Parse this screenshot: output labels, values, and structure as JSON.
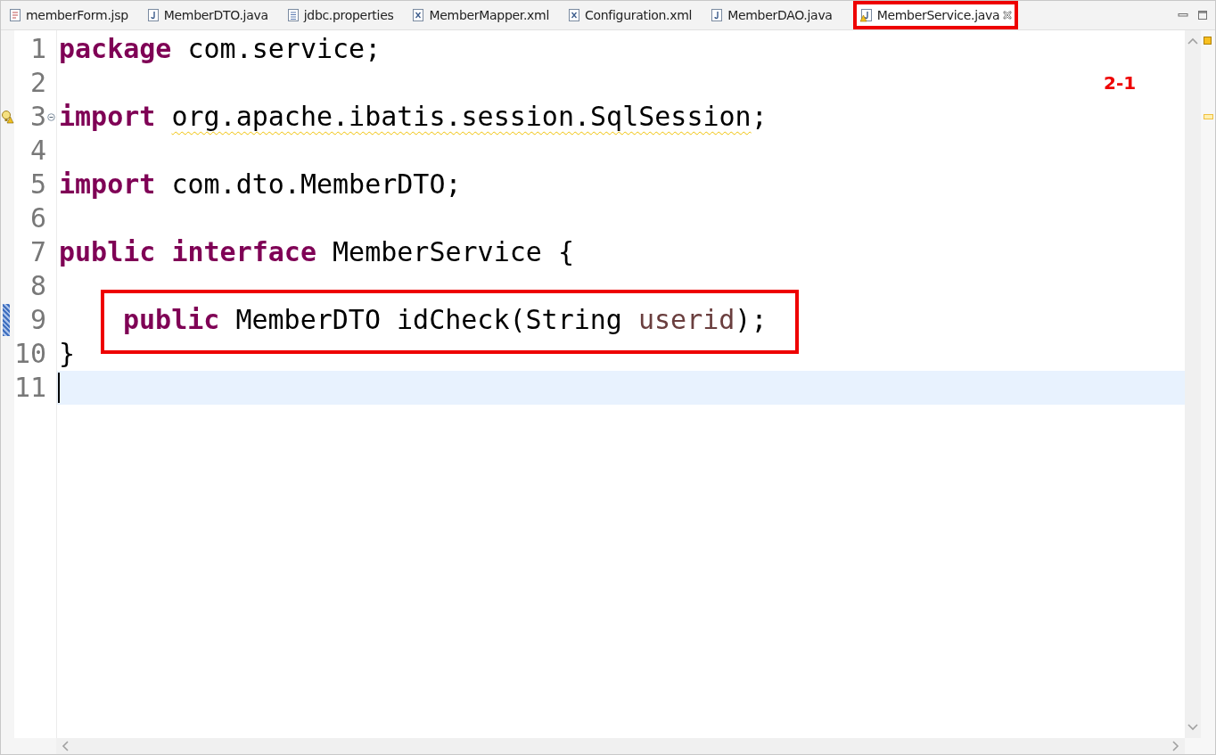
{
  "tabs": [
    {
      "label": "memberForm.jsp",
      "kind": "jsp",
      "selected": false,
      "highlighted": false
    },
    {
      "label": "MemberDTO.java",
      "kind": "java",
      "selected": false,
      "highlighted": false
    },
    {
      "label": "jdbc.properties",
      "kind": "properties",
      "selected": false,
      "highlighted": false
    },
    {
      "label": "MemberMapper.xml",
      "kind": "xml",
      "selected": false,
      "highlighted": false
    },
    {
      "label": "Configuration.xml",
      "kind": "xml",
      "selected": false,
      "highlighted": false
    },
    {
      "label": "MemberDAO.java",
      "kind": "java",
      "selected": false,
      "highlighted": false
    },
    {
      "label": "MemberService.java",
      "kind": "javawarning",
      "selected": true,
      "highlighted": true
    }
  ],
  "annotation": "2-1",
  "lines": [
    {
      "number": "1",
      "warning": false,
      "foldable": false,
      "changed": false,
      "indented": false,
      "highlighted": false,
      "current": false,
      "tokens": [
        {
          "text": "package ",
          "kind": "keyword"
        },
        {
          "text": "com.service;",
          "kind": "plain"
        }
      ]
    },
    {
      "number": "2",
      "warning": false,
      "foldable": false,
      "changed": false,
      "indented": false,
      "highlighted": false,
      "current": false
    },
    {
      "number": "3",
      "warning": true,
      "foldable": true,
      "changed": false,
      "indented": false,
      "highlighted": false,
      "current": false,
      "tokens": [
        {
          "text": "import ",
          "kind": "keyword"
        },
        {
          "text": "org.apache.ibatis.session.SqlSession",
          "kind": "warning"
        },
        {
          "text": ";",
          "kind": "plain"
        }
      ]
    },
    {
      "number": "4",
      "warning": false,
      "foldable": false,
      "changed": false,
      "indented": false,
      "highlighted": false,
      "current": false
    },
    {
      "number": "5",
      "warning": false,
      "foldable": false,
      "changed": false,
      "indented": false,
      "highlighted": false,
      "current": false,
      "tokens": [
        {
          "text": "import ",
          "kind": "keyword"
        },
        {
          "text": "com.dto.MemberDTO;",
          "kind": "plain"
        }
      ]
    },
    {
      "number": "6",
      "warning": false,
      "foldable": false,
      "changed": false,
      "indented": false,
      "highlighted": false,
      "current": false
    },
    {
      "number": "7",
      "warning": false,
      "foldable": false,
      "changed": false,
      "indented": false,
      "highlighted": false,
      "current": false,
      "tokens": [
        {
          "text": "public interface ",
          "kind": "keyword"
        },
        {
          "text": "MemberService {",
          "kind": "plain"
        }
      ]
    },
    {
      "number": "8",
      "warning": false,
      "foldable": false,
      "changed": false,
      "indented": false,
      "highlighted": false,
      "current": false
    },
    {
      "number": "9",
      "warning": false,
      "foldable": false,
      "changed": true,
      "indented": true,
      "highlighted": true,
      "current": false,
      "tokens": [
        {
          "text": "public ",
          "kind": "keyword"
        },
        {
          "text": "MemberDTO idCheck(String ",
          "kind": "plain"
        },
        {
          "text": "userid",
          "kind": "parameter"
        },
        {
          "text": ");",
          "kind": "plain"
        }
      ]
    },
    {
      "number": "10",
      "warning": false,
      "foldable": false,
      "changed": false,
      "indented": false,
      "highlighted": false,
      "current": false,
      "tokens": [
        {
          "text": "}",
          "kind": "plain"
        }
      ]
    },
    {
      "number": "11",
      "warning": false,
      "foldable": false,
      "changed": false,
      "indented": false,
      "highlighted": false,
      "current": true
    }
  ]
}
